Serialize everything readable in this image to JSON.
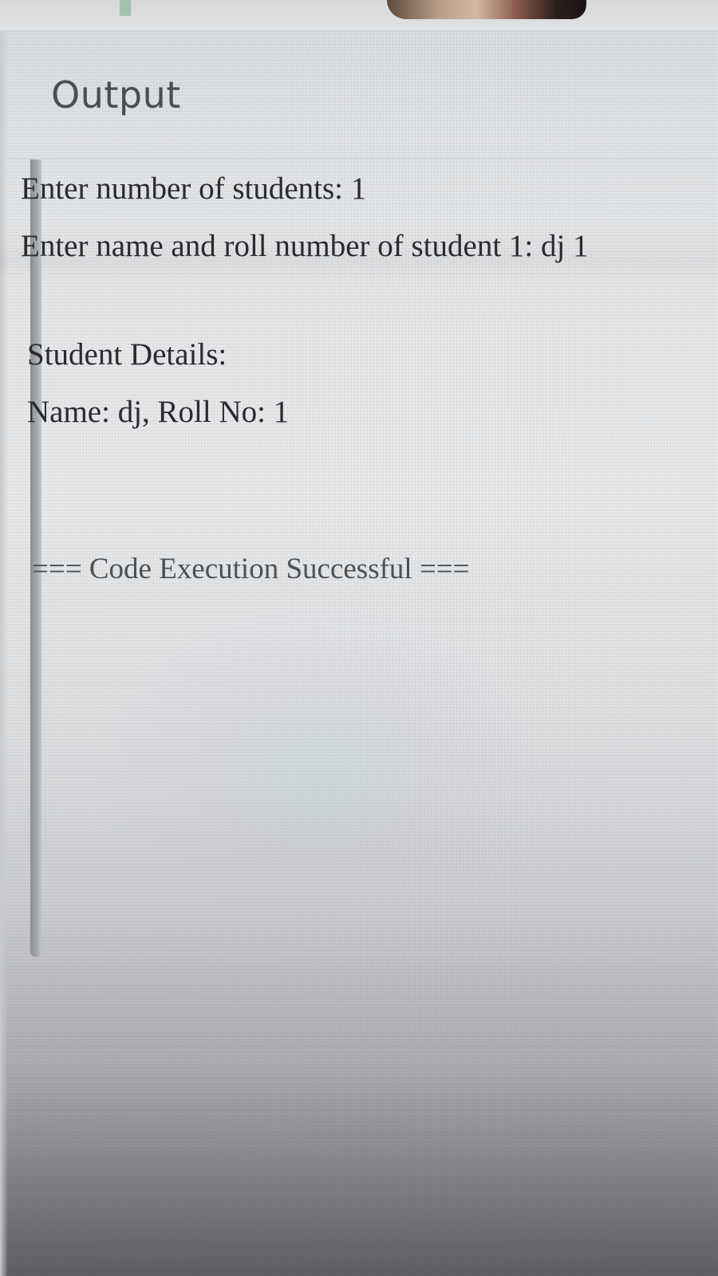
{
  "output_panel": {
    "title": "Output",
    "console_lines": [
      "Enter number of students: 1",
      "Enter name and roll number of student 1: dj 1",
      "Student Details:",
      "Name: dj, Roll No: 1",
      "=== Code Execution Successful ==="
    ]
  }
}
